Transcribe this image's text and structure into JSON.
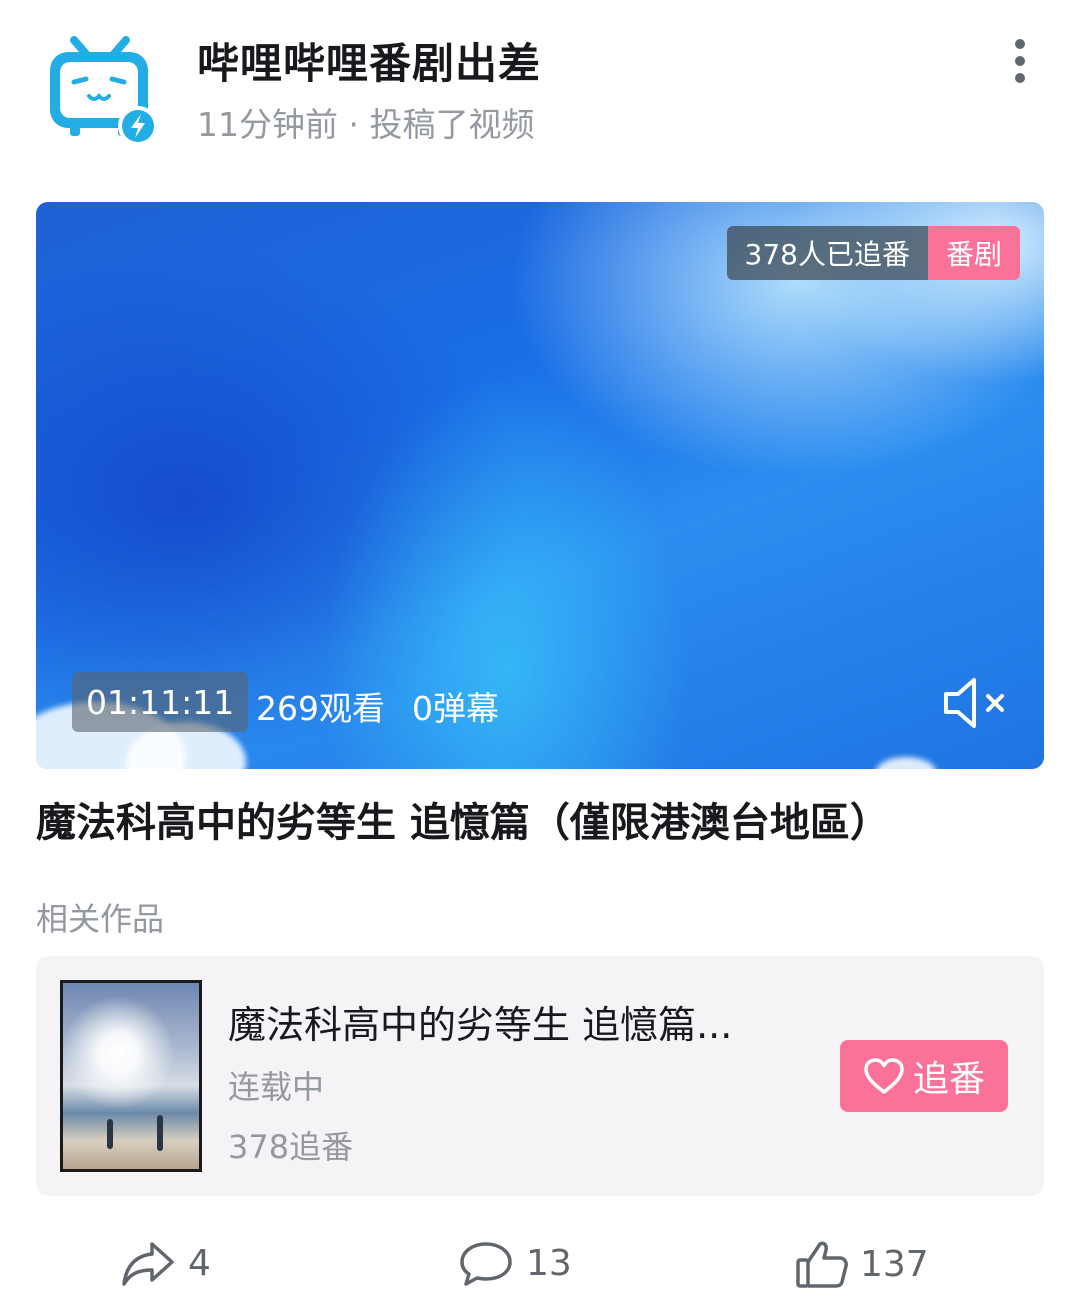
{
  "header": {
    "author_name": "哔哩哔哩番剧出差",
    "meta": "11分钟前 · 投稿了视频"
  },
  "video": {
    "follow_badge": "378人已追番",
    "type_badge": "番剧",
    "duration": "01:11:11",
    "views": "269观看",
    "danmaku": "0弹幕",
    "muted": true,
    "title": "魔法科高中的劣等生 追憶篇（僅限港澳台地區）"
  },
  "related": {
    "label": "相关作品",
    "work_title": "魔法科高中的劣等生 追憶篇...",
    "status": "连载中",
    "follows": "378追番",
    "follow_button": "追番"
  },
  "actions": {
    "share_count": "4",
    "comment_count": "13",
    "like_count": "137"
  },
  "colors": {
    "accent_pink": "#fb7299",
    "bili_blue": "#23ade5",
    "secondary_text": "#9499a0"
  }
}
